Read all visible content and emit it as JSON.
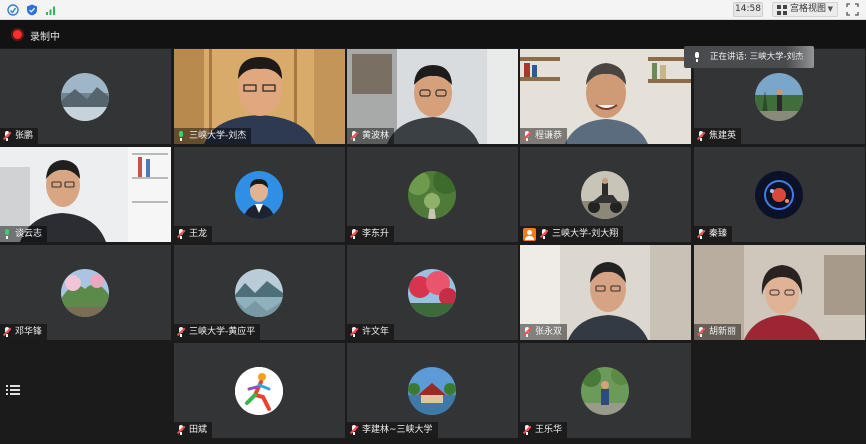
{
  "topbar": {
    "time": "14:58",
    "view_mode": "宫格视图"
  },
  "recording": {
    "label": "录制中"
  },
  "speaker": {
    "label": "正在讲话: 三峡大学-刘杰"
  },
  "participants": [
    {
      "name": "张鹏",
      "mic": "off",
      "kind": "avatar"
    },
    {
      "name": "三峡大学-刘杰",
      "mic": "on",
      "kind": "video"
    },
    {
      "name": "黄波林",
      "mic": "off",
      "kind": "video"
    },
    {
      "name": "程谦恭",
      "mic": "off",
      "kind": "video"
    },
    {
      "name": "焦建英",
      "mic": "off",
      "kind": "avatar"
    },
    {
      "name": "谈云志",
      "mic": "on",
      "kind": "video"
    },
    {
      "name": "王龙",
      "mic": "off",
      "kind": "avatar"
    },
    {
      "name": "李东升",
      "mic": "off",
      "kind": "avatar"
    },
    {
      "name": "三峡大学-刘大翔",
      "mic": "off",
      "kind": "avatar",
      "host": true
    },
    {
      "name": "秦臻",
      "mic": "off",
      "kind": "avatar"
    },
    {
      "name": "邓华锋",
      "mic": "off",
      "kind": "avatar"
    },
    {
      "name": "三峡大学-黄应平",
      "mic": "off",
      "kind": "avatar"
    },
    {
      "name": "许文年",
      "mic": "off",
      "kind": "avatar"
    },
    {
      "name": "张永双",
      "mic": "off",
      "kind": "video"
    },
    {
      "name": "胡新丽",
      "mic": "off",
      "kind": "video"
    },
    {
      "name": "田斌",
      "mic": "off",
      "kind": "avatar"
    },
    {
      "name": "李建林~三峡大学",
      "mic": "off",
      "kind": "avatar"
    },
    {
      "name": "王乐华",
      "mic": "off",
      "kind": "avatar"
    }
  ],
  "colors": {
    "tile_bg": "#333436",
    "mic_on": "#36d36a",
    "mic_off_slash": "#ff4d4f",
    "recording_dot": "#ff2d2d",
    "host_badge": "#f07c1b"
  }
}
